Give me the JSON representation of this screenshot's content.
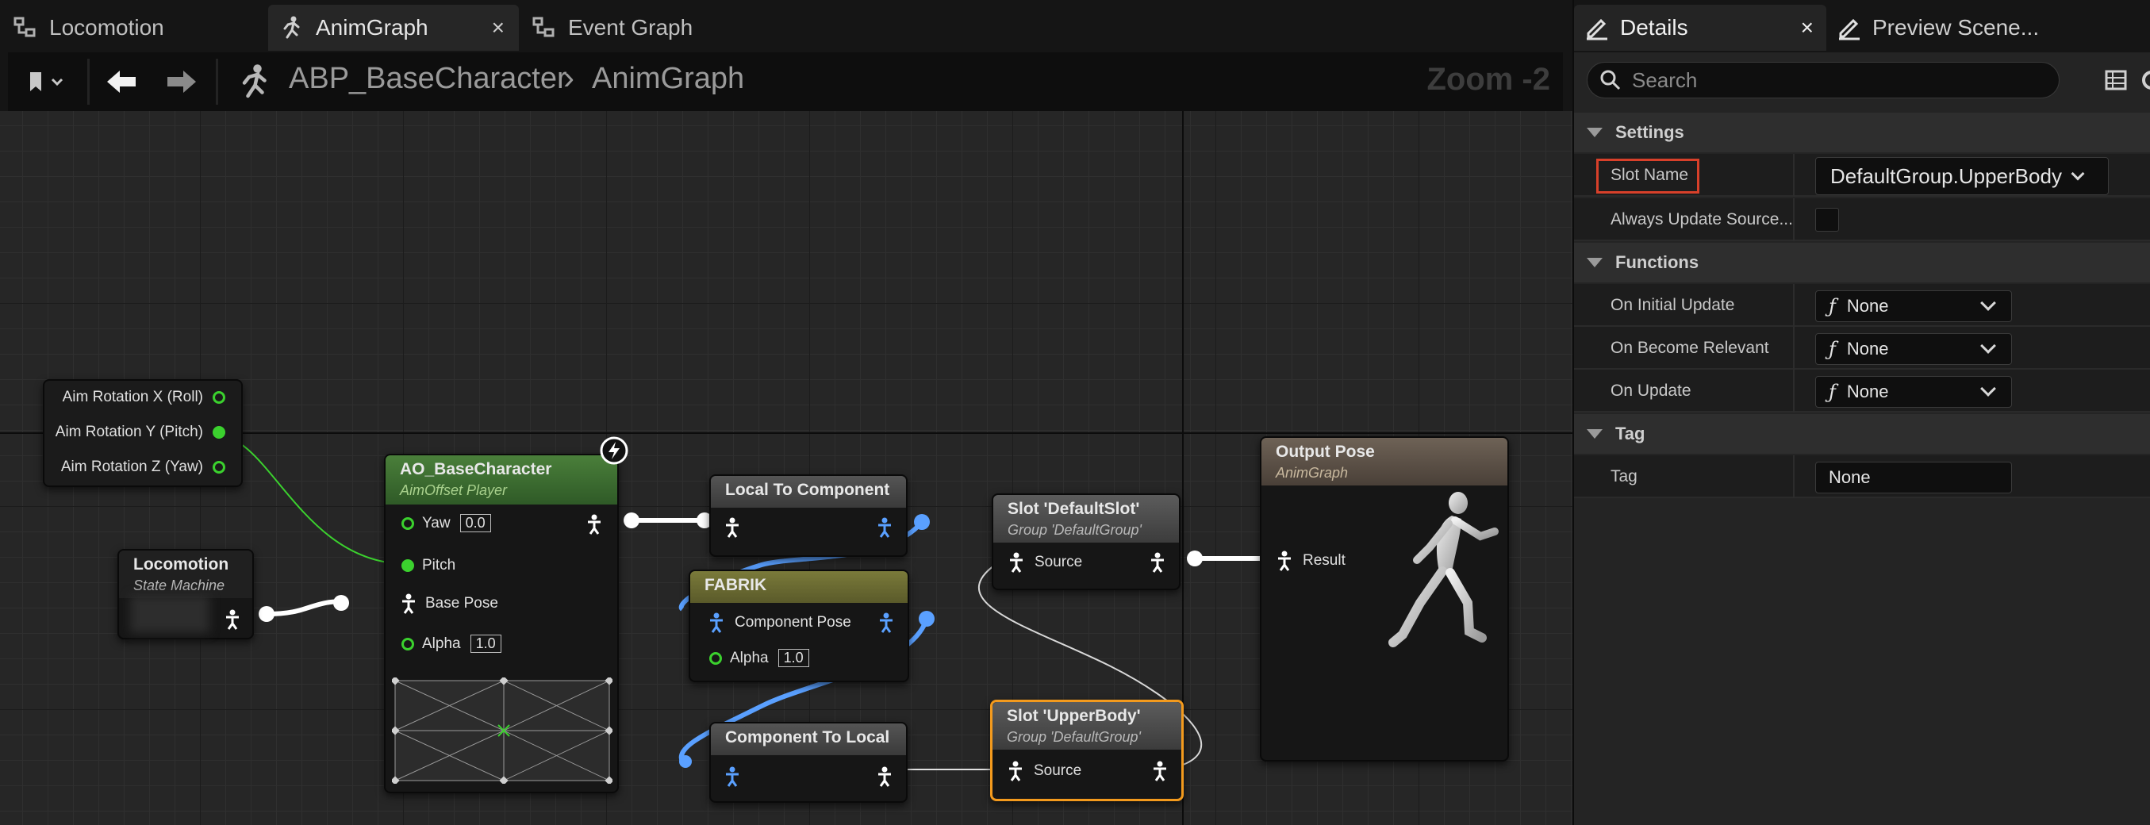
{
  "tabs": {
    "locomotion": "Locomotion",
    "animgraph": "AnimGraph",
    "animgraph_close": "×",
    "event_graph": "Event Graph"
  },
  "breadcrumb": {
    "asset": "ABP_BaseCharacter",
    "separator": "›",
    "graph": "AnimGraph",
    "zoom": "Zoom -2"
  },
  "nodes": {
    "aim_rotation": {
      "x": "Aim Rotation X (Roll)",
      "y": "Aim Rotation Y (Pitch)",
      "z": "Aim Rotation Z (Yaw)"
    },
    "locomotion": {
      "title": "Locomotion",
      "subtitle": "State Machine"
    },
    "ao": {
      "title": "AO_BaseCharacter",
      "subtitle": "AimOffset Player",
      "yaw_label": "Yaw",
      "yaw_value": "0.0",
      "pitch_label": "Pitch",
      "base_pose_label": "Base Pose",
      "alpha_label": "Alpha",
      "alpha_value": "1.0"
    },
    "local_to_component": {
      "title": "Local To Component"
    },
    "fabrik": {
      "title": "FABRIK",
      "component_pose_label": "Component Pose",
      "alpha_label": "Alpha",
      "alpha_value": "1.0"
    },
    "component_to_local": {
      "title": "Component To Local"
    },
    "slot_default": {
      "title": "Slot 'DefaultSlot'",
      "subtitle": "Group 'DefaultGroup'",
      "source_label": "Source"
    },
    "slot_upper": {
      "title": "Slot 'UpperBody'",
      "subtitle": "Group 'DefaultGroup'",
      "source_label": "Source"
    },
    "output_pose": {
      "title": "Output Pose",
      "subtitle": "AnimGraph",
      "result_label": "Result"
    }
  },
  "details": {
    "tab_label": "Details",
    "tab_close": "×",
    "preview_tab_label": "Preview Scene...",
    "search_placeholder": "Search",
    "sections": {
      "settings": "Settings",
      "functions": "Functions",
      "tag": "Tag"
    },
    "props": {
      "slot_name_label": "Slot Name",
      "slot_name_value": "DefaultGroup.UpperBody",
      "always_update_label": "Always Update Source...",
      "on_initial_update_label": "On Initial Update",
      "on_initial_update_value": "None",
      "on_become_relevant_label": "On Become Relevant",
      "on_become_relevant_value": "None",
      "on_update_label": "On Update",
      "on_update_value": "None",
      "tag_label": "Tag",
      "tag_value": "None"
    }
  },
  "colors": {
    "exec_pin_green": "#3bd12e",
    "pose_pin_blue": "#5aa0ff",
    "selected_node_outline": "#f39a1d",
    "highlight_box": "#d8402a"
  }
}
